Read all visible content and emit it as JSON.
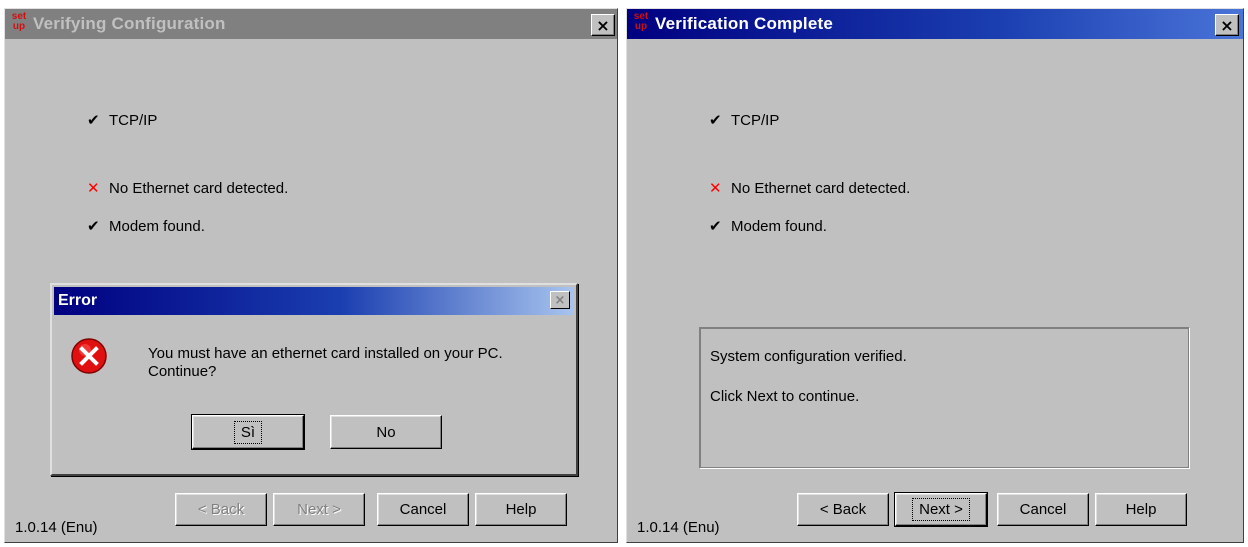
{
  "left_window": {
    "title": "Verifying Configuration",
    "icon_text_top": "set",
    "icon_text_bottom": "up",
    "close_glyph": "×",
    "items": [
      {
        "status": "ok",
        "glyph": "✔",
        "label": "TCP/IP"
      },
      {
        "status": "fail",
        "glyph": "✕",
        "label": "No Ethernet card detected."
      },
      {
        "status": "ok",
        "glyph": "✔",
        "label": "Modem found."
      }
    ],
    "buttons": {
      "back": "< Back",
      "next": "Next >",
      "cancel": "Cancel",
      "help": "Help"
    },
    "version": "1.0.14 (Enu)"
  },
  "error_dialog": {
    "title": "Error",
    "close_glyph": "×",
    "message_line1": "You must have an ethernet card installed on your PC.",
    "message_line2": "Continue?",
    "yes_label": "Sì",
    "no_label": "No",
    "icon": "error-icon"
  },
  "right_window": {
    "title": "Verification Complete",
    "icon_text_top": "set",
    "icon_text_bottom": "up",
    "close_glyph": "×",
    "items": [
      {
        "status": "ok",
        "glyph": "✔",
        "label": "TCP/IP"
      },
      {
        "status": "fail",
        "glyph": "✕",
        "label": "No Ethernet card detected."
      },
      {
        "status": "ok",
        "glyph": "✔",
        "label": "Modem found."
      }
    ],
    "message_line1": "System configuration verified.",
    "message_line2": "Click Next to continue.",
    "buttons": {
      "back": "< Back",
      "next": "Next >",
      "cancel": "Cancel",
      "help": "Help"
    },
    "version": "1.0.14 (Enu)"
  },
  "colors": {
    "dialog_face": "#c0c0c0",
    "active_title": "#000080",
    "inactive_title": "#808080",
    "fail_mark": "#ff0000"
  }
}
